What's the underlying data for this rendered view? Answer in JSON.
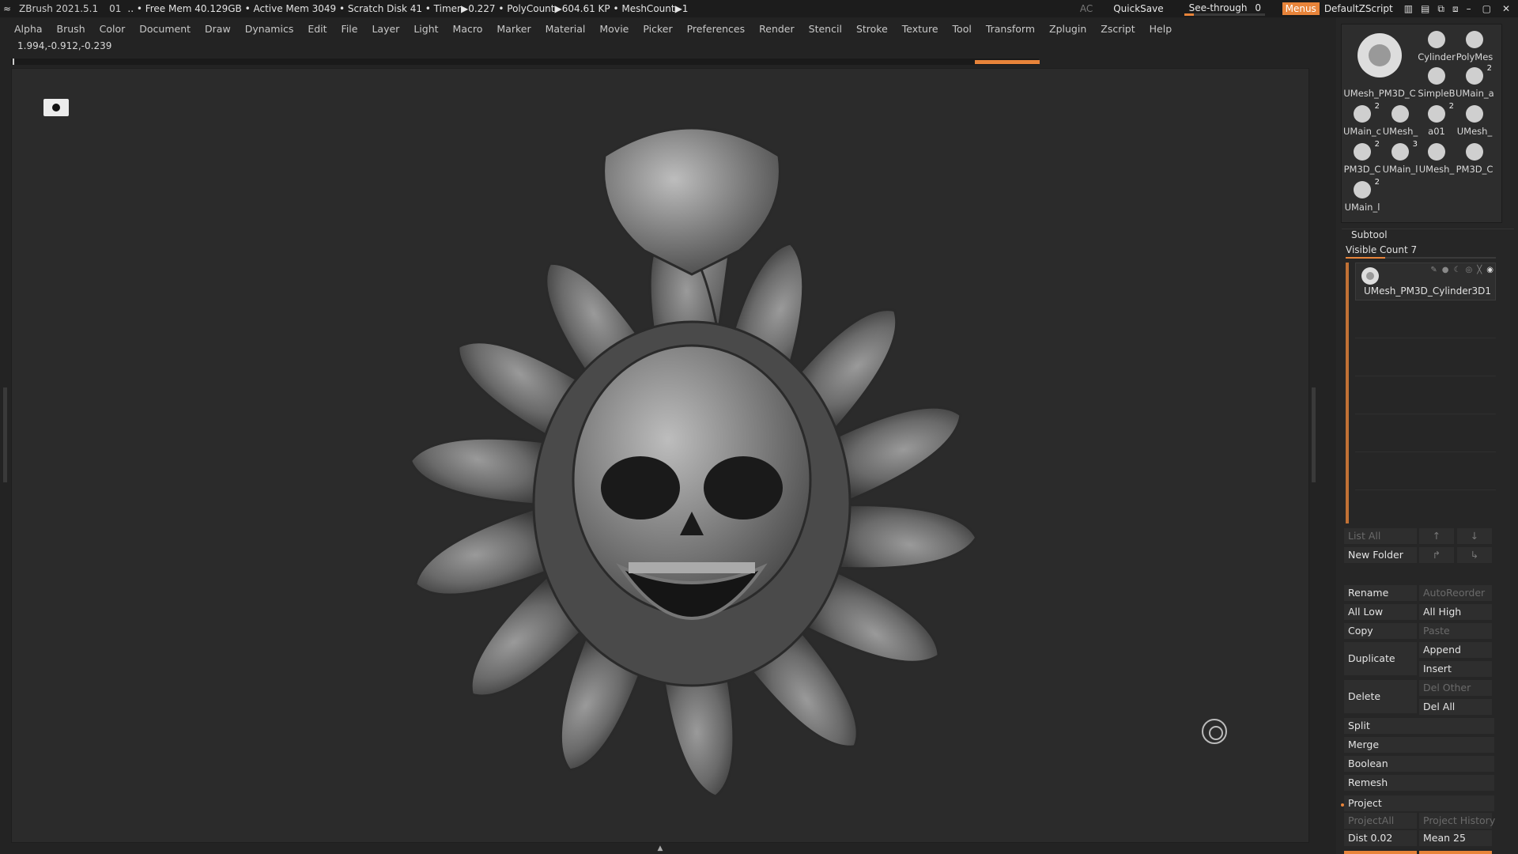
{
  "titlebar": {
    "app": "ZBrush 2021.5.1",
    "doc": "01",
    "status": ".. • Free Mem 40.129GB • Active Mem 3049 • Scratch Disk 41 •  Timer▶0.227 • PolyCount▶604.61 KP  • MeshCount▶1",
    "ac": "AC",
    "quicksave": "QuickSave",
    "see_through_label": "See-through",
    "see_through_value": "0",
    "menus": "Menus",
    "script": "DefaultZScript"
  },
  "menubar": [
    "Alpha",
    "Brush",
    "Color",
    "Document",
    "Draw",
    "Dynamics",
    "Edit",
    "File",
    "Layer",
    "Light",
    "Macro",
    "Marker",
    "Material",
    "Movie",
    "Picker",
    "Preferences",
    "Render",
    "Stencil",
    "Stroke",
    "Texture",
    "Tool",
    "Transform",
    "Zplugin",
    "Zscript",
    "Help"
  ],
  "coords": "1.994,-0.912,-0.239",
  "tools": {
    "big": {
      "caption": "UMesh_PM3D_C"
    },
    "cells": [
      {
        "caption": "Cylinder",
        "badge": ""
      },
      {
        "caption": "PolyMes",
        "badge": ""
      },
      {
        "caption": "SimpleB",
        "badge": ""
      },
      {
        "caption": "UMain_a",
        "badge": "2"
      },
      {
        "caption": "UMain_c",
        "badge": "2"
      },
      {
        "caption": "UMesh_",
        "badge": ""
      },
      {
        "caption": "a01",
        "badge": "2"
      },
      {
        "caption": "UMesh_",
        "badge": ""
      },
      {
        "caption": "PM3D_C",
        "badge": "2"
      },
      {
        "caption": "UMain_l",
        "badge": "3"
      },
      {
        "caption": "UMesh_",
        "badge": ""
      },
      {
        "caption": "PM3D_C",
        "badge": ""
      },
      {
        "caption": "UMain_l",
        "badge": "2"
      }
    ]
  },
  "subtool": {
    "title": "Subtool",
    "visible_count": "Visible Count 7",
    "item_name": "UMesh_PM3D_Cylinder3D1"
  },
  "buttons": {
    "list_all": "List All",
    "new_folder": "New Folder",
    "rename": "Rename",
    "auto_reorder": "AutoReorder",
    "all_low": "All Low",
    "all_high": "All High",
    "copy": "Copy",
    "paste": "Paste",
    "duplicate": "Duplicate",
    "append": "Append",
    "insert": "Insert",
    "delete": "Delete",
    "del_other": "Del Other",
    "del_all": "Del All",
    "split": "Split",
    "merge": "Merge",
    "boolean": "Boolean",
    "remesh": "Remesh",
    "project": "Project",
    "project_all": "ProjectAll",
    "project_history": "Project History",
    "dist": "Dist 0.02",
    "mean": "Mean 25"
  },
  "colors": {
    "accent": "#e8843a",
    "background": "#232323",
    "viewport": "#2b2b2b"
  },
  "icons": [
    "zbrush-logo-icon",
    "camera-icon",
    "gizmo-icon",
    "eye-icon",
    "arrow-up-icon",
    "arrow-down-icon"
  ]
}
